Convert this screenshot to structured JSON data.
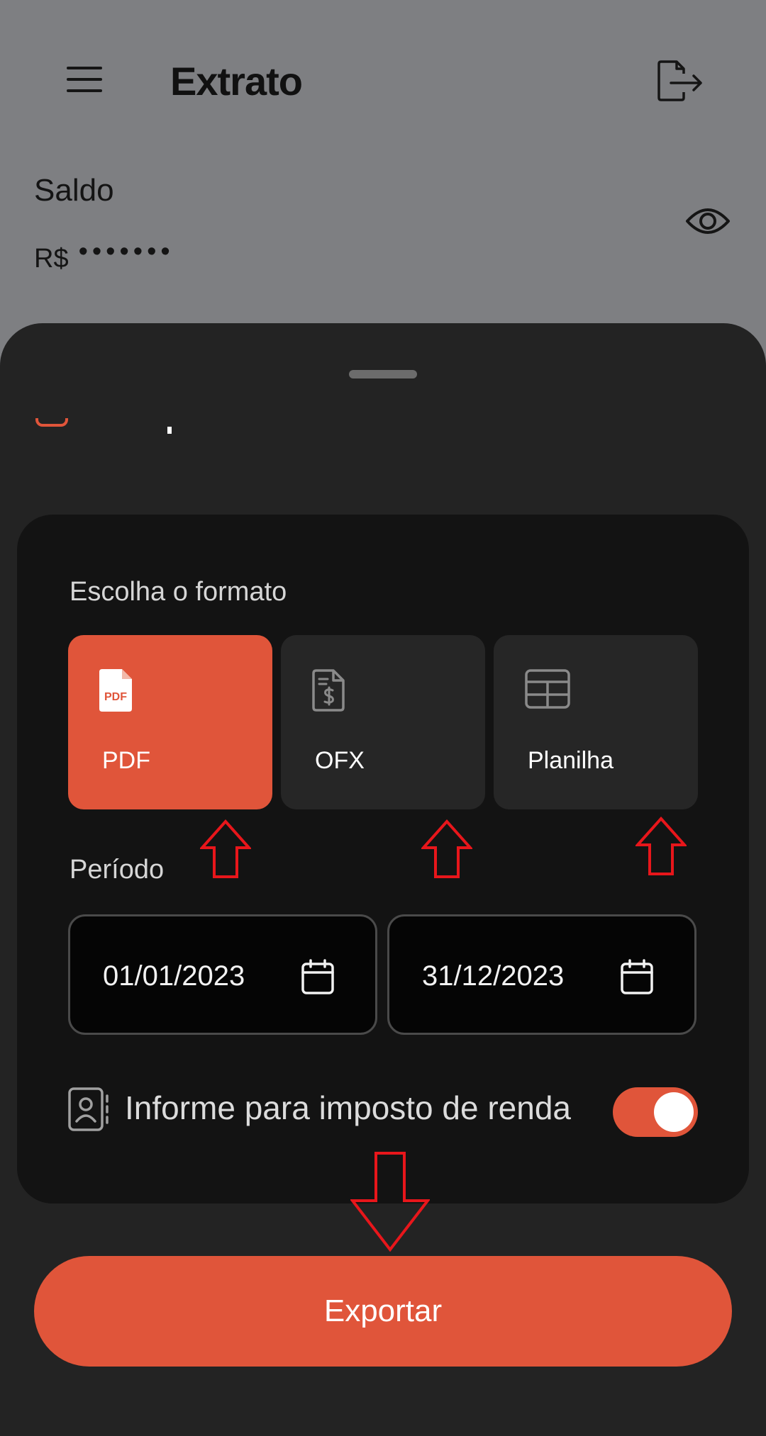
{
  "header": {
    "title": "Extrato",
    "menu_icon": "hamburger-menu-icon",
    "export_icon": "file-export-icon"
  },
  "balance": {
    "label": "Saldo",
    "currency": "R$",
    "hidden_value": "•••••••",
    "visibility_icon": "eye-icon"
  },
  "sheet": {
    "format_section_label": "Escolha o formato",
    "formats": [
      {
        "label": "PDF",
        "icon": "pdf-file-icon",
        "selected": true
      },
      {
        "label": "OFX",
        "icon": "dollar-document-icon",
        "selected": false
      },
      {
        "label": "Planilha",
        "icon": "spreadsheet-icon",
        "selected": false
      }
    ],
    "period_section_label": "Período",
    "start_date": "01/01/2023",
    "end_date": "31/12/2023",
    "date_icon": "calendar-icon",
    "tax_report_label": "Informe para imposto de renda",
    "tax_report_icon": "contact-card-icon",
    "tax_report_enabled": true,
    "export_button_label": "Exportar"
  },
  "colors": {
    "accent": "#e0553a",
    "sheet_background": "#232323",
    "card_background": "#131313",
    "scrim_background": "#7e7f82",
    "annotation_arrow": "#e8161b"
  }
}
